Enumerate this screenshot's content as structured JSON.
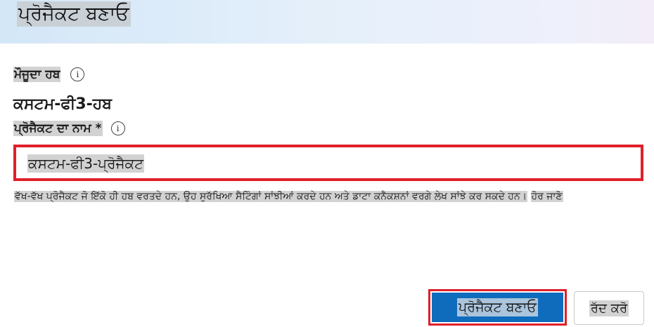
{
  "dialog": {
    "title": "ਪ੍ਰੋਜੈਕਟ ਬਣਾਓ"
  },
  "hub": {
    "label": "ਮੌਜੂਦਾ ਹਬ",
    "value": "ਕਸਟਮ-ਫੀ3-ਹਬ",
    "info_icon": "info-icon"
  },
  "project_name": {
    "label": "ਪ੍ਰੋਜੈਕਟ ਦਾ ਨਾਮ *",
    "value": "ਕਸਟਮ-ਫੀ3-ਪ੍ਰੋਜੈਕਟ",
    "info_icon": "info-icon"
  },
  "help": {
    "text": "ਵੱਖ-ਵੱਖ ਪ੍ਰੋਜੈਕਟ ਜੋ ਇੱਕੋ ਹੀ ਹਬ ਵਰਤਦੇ ਹਨ, ਉਹ ਸੁਰੱਖਿਆ ਸੈਟਿੰਗਾਂ ਸਾਂਝੀਆਂ ਕਰਦੇ ਹਨ ਅਤੇ ਡਾਟਾ ਕਨੈਕਸ਼ਨਾਂ ਵਰਗੇ ਲੇਖ ਸਾਂਝੇ ਕਰ ਸਕਦੇ ਹਨ।",
    "link": "ਹੋਰ ਜਾਣੋ"
  },
  "actions": {
    "create_label": "ਪ੍ਰੋਜੈਕਟ ਬਣਾਓ",
    "cancel_label": "ਰੱਦ ਕਰੋ"
  },
  "colors": {
    "primary": "#0f6cbd",
    "highlight_border": "#e0202a"
  }
}
